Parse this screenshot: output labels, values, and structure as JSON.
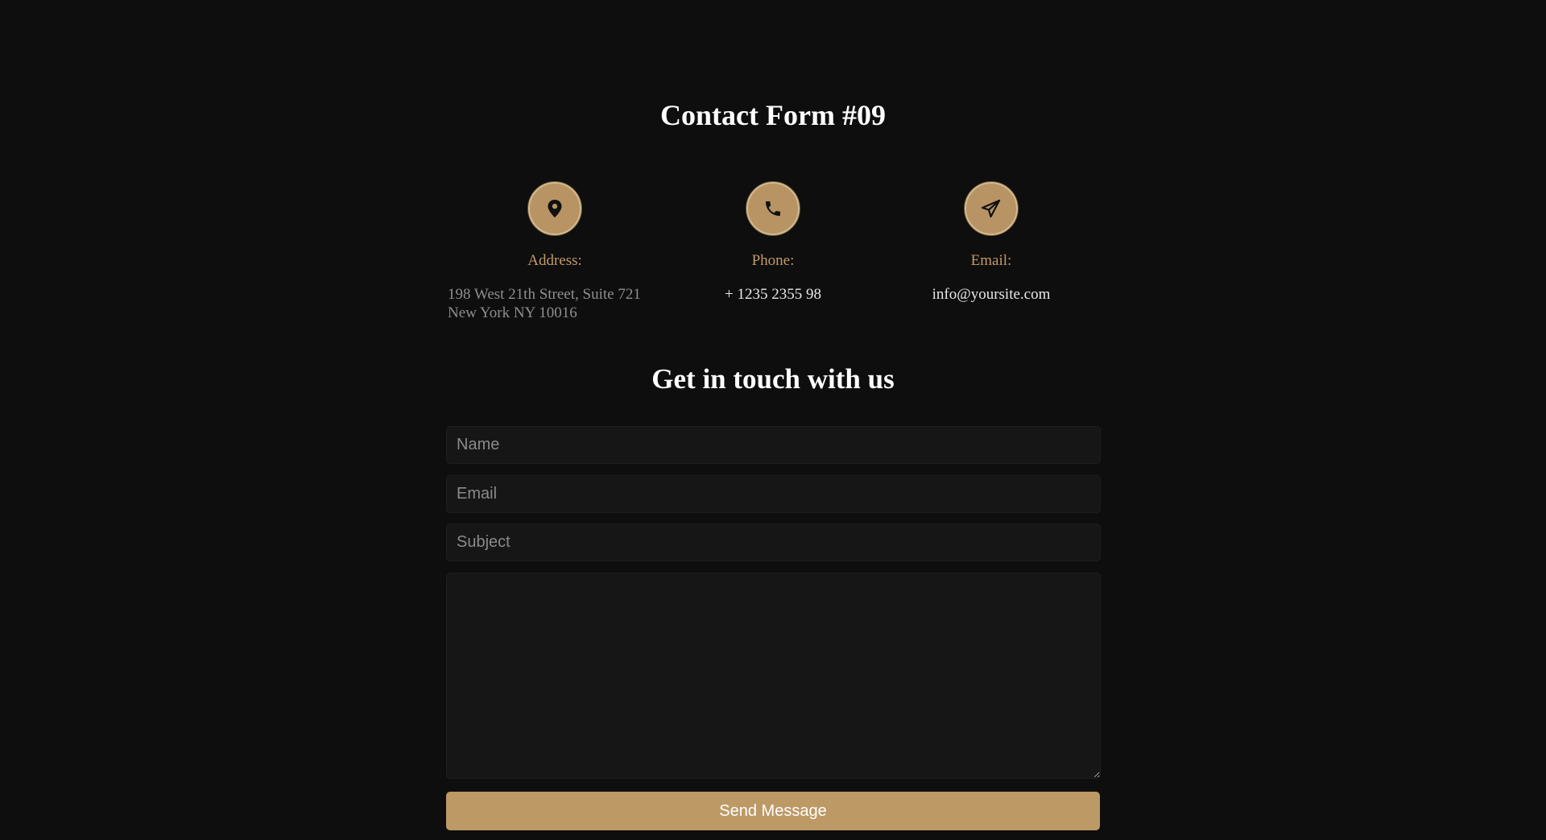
{
  "page": {
    "title": "Contact Form #09",
    "subtitle": "Get in touch with us"
  },
  "contact_info": {
    "address": {
      "icon": "map-pin-icon",
      "label": "Address:",
      "value": "198 West 21th Street, Suite 721 New York NY 10016"
    },
    "phone": {
      "icon": "phone-icon",
      "label": "Phone:",
      "value": "+ 1235 2355 98"
    },
    "email": {
      "icon": "paper-plane-icon",
      "label": "Email:",
      "value": "info@yoursite.com"
    }
  },
  "form": {
    "name_placeholder": "Name",
    "name_value": "",
    "email_placeholder": "Email",
    "email_value": "",
    "subject_placeholder": "Subject",
    "subject_value": "",
    "message_placeholder": "",
    "message_value": "",
    "submit_label": "Send Message"
  },
  "colors": {
    "background": "#0e0e0e",
    "accent": "#bd9965",
    "label_accent": "#c39a68",
    "field_background": "#161616"
  }
}
